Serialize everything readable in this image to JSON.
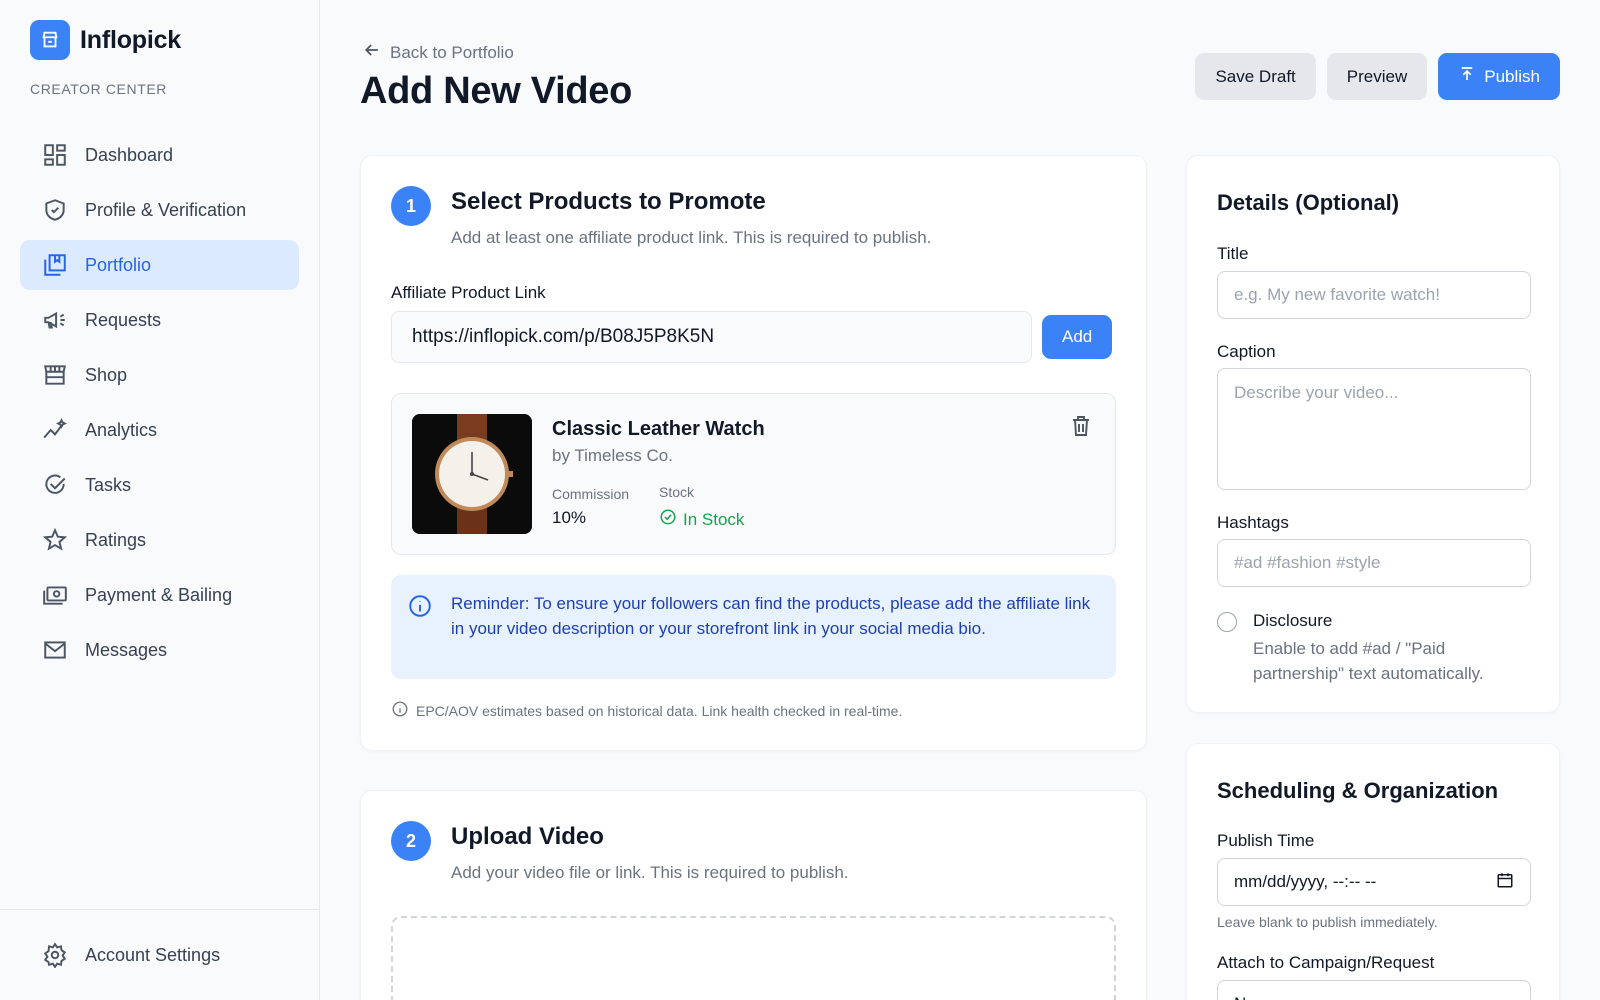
{
  "brand": {
    "name": "Inflopick",
    "section_label": "CREATOR CENTER"
  },
  "nav": [
    {
      "label": "Dashboard",
      "icon": "dashboard-icon",
      "active": false
    },
    {
      "label": "Profile & Verification",
      "icon": "shield-icon",
      "active": false
    },
    {
      "label": "Portfolio",
      "icon": "portfolio-icon",
      "active": true
    },
    {
      "label": "Requests",
      "icon": "megaphone-icon",
      "active": false
    },
    {
      "label": "Shop",
      "icon": "store-icon",
      "active": false
    },
    {
      "label": "Analytics",
      "icon": "analytics-icon",
      "active": false
    },
    {
      "label": "Tasks",
      "icon": "check-circle-icon",
      "active": false
    },
    {
      "label": "Ratings",
      "icon": "star-icon",
      "active": false
    },
    {
      "label": "Payment & Bailing",
      "icon": "payment-icon",
      "active": false
    },
    {
      "label": "Messages",
      "icon": "mail-icon",
      "active": false
    }
  ],
  "account_settings": "Account Settings",
  "header": {
    "back": "Back to Portfolio",
    "title": "Add New Video",
    "save_draft": "Save Draft",
    "preview": "Preview",
    "publish": "Publish"
  },
  "step1": {
    "number": "1",
    "title": "Select Products to Promote",
    "subtitle": "Add at least one affiliate product link. This is required to publish.",
    "link_label": "Affiliate Product Link",
    "link_value": "https://inflopick.com/p/B08J5P8K5N",
    "add_label": "Add",
    "product": {
      "name": "Classic Leather Watch",
      "brand": "by Timeless Co.",
      "commission_label": "Commission",
      "commission_value": "10%",
      "stock_label": "Stock",
      "stock_value": "In Stock"
    },
    "reminder": "Reminder: To ensure your followers can find the products, please add the affiliate link in your video description or your storefront link in your social media bio.",
    "note": "EPC/AOV estimates based on historical data. Link health checked in real-time."
  },
  "step2": {
    "number": "2",
    "title": "Upload Video",
    "subtitle": "Add your video file or link. This is required to publish."
  },
  "details": {
    "title": "Details (Optional)",
    "title_label": "Title",
    "title_placeholder": "e.g. My new favorite watch!",
    "caption_label": "Caption",
    "caption_placeholder": "Describe your video...",
    "hashtags_label": "Hashtags",
    "hashtags_placeholder": "#ad #fashion #style",
    "disclosure_label": "Disclosure",
    "disclosure_desc": "Enable to add #ad / \"Paid partnership\" text automatically."
  },
  "scheduling": {
    "title": "Scheduling & Organization",
    "publish_time_label": "Publish Time",
    "publish_time_placeholder": "mm/dd/yyyy, --:-- --",
    "publish_time_note": "Leave blank to publish immediately.",
    "campaign_label": "Attach to Campaign/Request",
    "campaign_value": "No"
  },
  "colors": {
    "accent": "#3b82f6",
    "success": "#16a34a",
    "info_bg": "#e8f1fe"
  }
}
